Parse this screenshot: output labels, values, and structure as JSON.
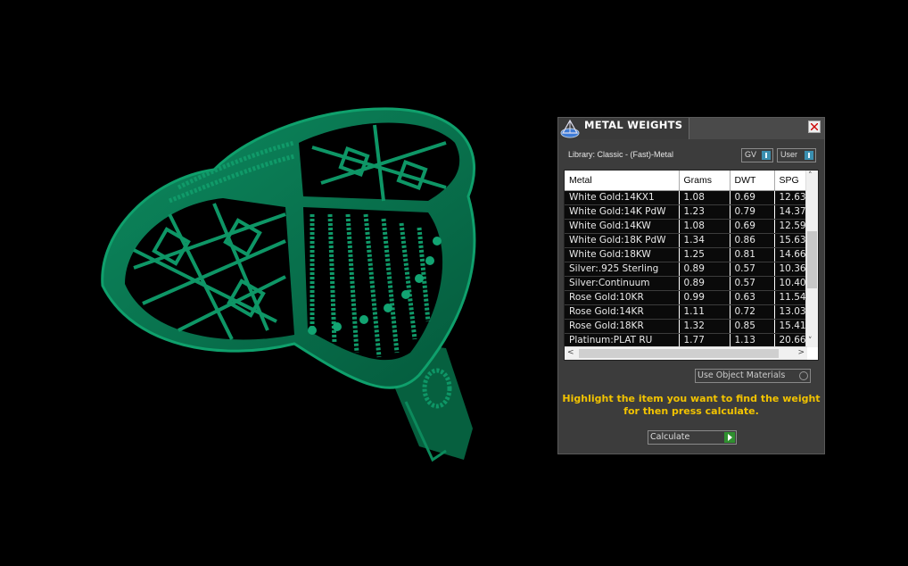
{
  "panel": {
    "title": "METAL WEIGHTS",
    "library_label": "Library: Classic - (Fast)-Metal",
    "toggle_gv": "GV",
    "toggle_user": "User",
    "columns": [
      "Metal",
      "Grams",
      "DWT",
      "SPG"
    ],
    "rows": [
      [
        "White Gold:14KX1",
        "1.08",
        "0.69",
        "12.63"
      ],
      [
        "White Gold:14K PdW",
        "1.23",
        "0.79",
        "14.37"
      ],
      [
        "White Gold:14KW",
        "1.08",
        "0.69",
        "12.59"
      ],
      [
        "White Gold:18K PdW",
        "1.34",
        "0.86",
        "15.63"
      ],
      [
        "White Gold:18KW",
        "1.25",
        "0.81",
        "14.66"
      ],
      [
        "Silver:.925 Sterling",
        "0.89",
        "0.57",
        "10.36"
      ],
      [
        "Silver:Continuum",
        "0.89",
        "0.57",
        "10.40"
      ],
      [
        "Rose Gold:10KR",
        "0.99",
        "0.63",
        "11.54"
      ],
      [
        "Rose Gold:14KR",
        "1.11",
        "0.72",
        "13.03"
      ],
      [
        "Rose Gold:18KR",
        "1.32",
        "0.85",
        "15.41"
      ],
      [
        "Platinum:PLAT RU",
        "1.77",
        "1.13",
        "20.66"
      ]
    ],
    "use_object_materials": "Use Object Materials",
    "hint": "Highlight the item you want to find the weight for then press calculate.",
    "calculate_label": "Calculate"
  },
  "viewport": {
    "model_color": "#0a7a55"
  }
}
